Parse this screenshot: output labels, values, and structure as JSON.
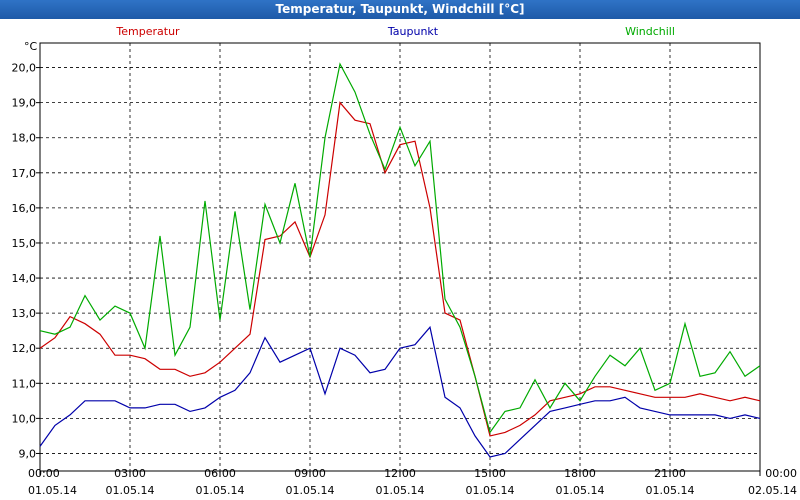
{
  "window": {
    "title": "Temperatur, Taupunkt, Windchill [°C]"
  },
  "chart_data": {
    "type": "line",
    "title": "Temperatur, Taupunkt, Windchill [°C]",
    "ylabel": "°C",
    "ylim": [
      8.5,
      20.7
    ],
    "xlim": [
      0,
      24
    ],
    "grid": true,
    "legend": "top",
    "y_ticks": [
      "9,0",
      "10,0",
      "11,0",
      "12,0",
      "13,0",
      "14,0",
      "15,0",
      "16,0",
      "17,0",
      "18,0",
      "19,0",
      "20,0"
    ],
    "x_ticks": [
      {
        "time": "00:00",
        "date": "01.05.14"
      },
      {
        "time": "03:00",
        "date": "01.05.14"
      },
      {
        "time": "06:00",
        "date": "01.05.14"
      },
      {
        "time": "09:00",
        "date": "01.05.14"
      },
      {
        "time": "12:00",
        "date": "01.05.14"
      },
      {
        "time": "15:00",
        "date": "01.05.14"
      },
      {
        "time": "18:00",
        "date": "01.05.14"
      },
      {
        "time": "21:00",
        "date": "01.05.14"
      },
      {
        "time": "00:00",
        "date": "02.05.14"
      }
    ],
    "x_hours": [
      0,
      0.5,
      1,
      1.5,
      2,
      2.5,
      3,
      3.5,
      4,
      4.5,
      5,
      5.5,
      6,
      6.5,
      7,
      7.5,
      8,
      8.5,
      9,
      9.5,
      10,
      10.5,
      11,
      11.5,
      12,
      12.5,
      13,
      13.5,
      14,
      14.5,
      15,
      15.5,
      16,
      16.5,
      17,
      17.5,
      18,
      18.5,
      19,
      19.5,
      20,
      20.5,
      21,
      21.5,
      22,
      22.5,
      23,
      23.5,
      24
    ],
    "series": [
      {
        "name": "Temperatur",
        "color": "#cc0000",
        "values": [
          12.0,
          12.3,
          12.9,
          12.7,
          12.4,
          11.8,
          11.8,
          11.7,
          11.4,
          11.4,
          11.2,
          11.3,
          11.6,
          12.0,
          12.4,
          15.1,
          15.2,
          15.6,
          14.6,
          15.8,
          19.0,
          18.5,
          18.4,
          17.0,
          17.8,
          17.9,
          16.0,
          13.0,
          12.8,
          11.2,
          9.5,
          9.6,
          9.8,
          10.1,
          10.5,
          10.6,
          10.7,
          10.9,
          10.9,
          10.8,
          10.7,
          10.6,
          10.6,
          10.6,
          10.7,
          10.6,
          10.5,
          10.6,
          10.5
        ]
      },
      {
        "name": "Taupunkt",
        "color": "#0000aa",
        "values": [
          9.2,
          9.8,
          10.1,
          10.5,
          10.5,
          10.5,
          10.3,
          10.3,
          10.4,
          10.4,
          10.2,
          10.3,
          10.6,
          10.8,
          11.3,
          12.3,
          11.6,
          11.8,
          12.0,
          10.7,
          12.0,
          11.8,
          11.3,
          11.4,
          12.0,
          12.1,
          12.6,
          10.6,
          10.3,
          9.5,
          8.9,
          9.0,
          9.4,
          9.8,
          10.2,
          10.3,
          10.4,
          10.5,
          10.5,
          10.6,
          10.3,
          10.2,
          10.1,
          10.1,
          10.1,
          10.1,
          10.0,
          10.1,
          10.0
        ]
      },
      {
        "name": "Windchill",
        "color": "#00aa00",
        "values": [
          12.5,
          12.4,
          12.6,
          13.5,
          12.8,
          13.2,
          13.0,
          12.0,
          15.2,
          11.8,
          12.6,
          16.2,
          12.8,
          15.9,
          13.1,
          16.1,
          15.0,
          16.7,
          14.6,
          18.0,
          20.1,
          19.3,
          18.1,
          17.1,
          18.3,
          17.2,
          17.9,
          13.4,
          12.6,
          11.2,
          9.6,
          10.2,
          10.3,
          11.1,
          10.3,
          11.0,
          10.5,
          11.2,
          11.8,
          11.5,
          12.0,
          10.8,
          11.0,
          12.7,
          11.2,
          11.3,
          11.9,
          11.2,
          11.5
        ]
      }
    ]
  }
}
